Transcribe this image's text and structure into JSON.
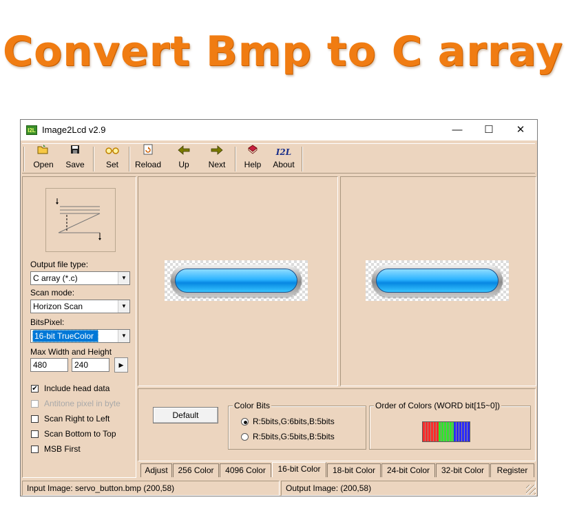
{
  "headline": "Convert Bmp to C array",
  "window": {
    "title": "Image2Lcd v2.9",
    "icon_text": "I2L",
    "controls": {
      "minimize": "—",
      "maximize": "☐",
      "close": "✕"
    }
  },
  "toolbar": {
    "open": "Open",
    "save": "Save",
    "set": "Set",
    "reload": "Reload",
    "up": "Up",
    "next": "Next",
    "help": "Help",
    "about": "About",
    "about_icon_text": "I2L"
  },
  "left": {
    "output_type_label": "Output file type:",
    "output_type_value": "C array (*.c)",
    "scan_mode_label": "Scan mode:",
    "scan_mode_value": "Horizon Scan",
    "bits_label": "BitsPixel:",
    "bits_value": "16-bit TrueColor",
    "max_label": "Max Width and Height",
    "max_width": "480",
    "max_height": "240",
    "checks": [
      {
        "label": "Include head data",
        "checked": true,
        "enabled": true
      },
      {
        "label": "Antitone pixel in byte",
        "checked": false,
        "enabled": false
      },
      {
        "label": "Scan Right to Left",
        "checked": false,
        "enabled": true
      },
      {
        "label": "Scan Bottom to Top",
        "checked": false,
        "enabled": true
      },
      {
        "label": "MSB First",
        "checked": false,
        "enabled": true
      }
    ]
  },
  "bottom": {
    "default_button": "Default",
    "color_bits_title": "Color Bits",
    "option_565": "R:5bits,G:6bits,B:5bits",
    "option_555": "R:5bits,G:5bits,B:5bits",
    "order_title": "Order of Colors (WORD bit[15~0])",
    "colors": {
      "red": "#ff2a2a",
      "green": "#2ee62e",
      "blue": "#2a2aff"
    }
  },
  "tabs": [
    "Adjust",
    "256 Color",
    "4096 Color",
    "16-bit Color",
    "18-bit Color",
    "24-bit Color",
    "32-bit Color",
    "Register"
  ],
  "active_tab": "16-bit Color",
  "status": {
    "input": "Input Image: servo_button.bmp (200,58)",
    "output": "Output Image: (200,58)"
  },
  "accent_colors": {
    "headline": "#f07c12",
    "window_bg": "#ecd5bf"
  }
}
